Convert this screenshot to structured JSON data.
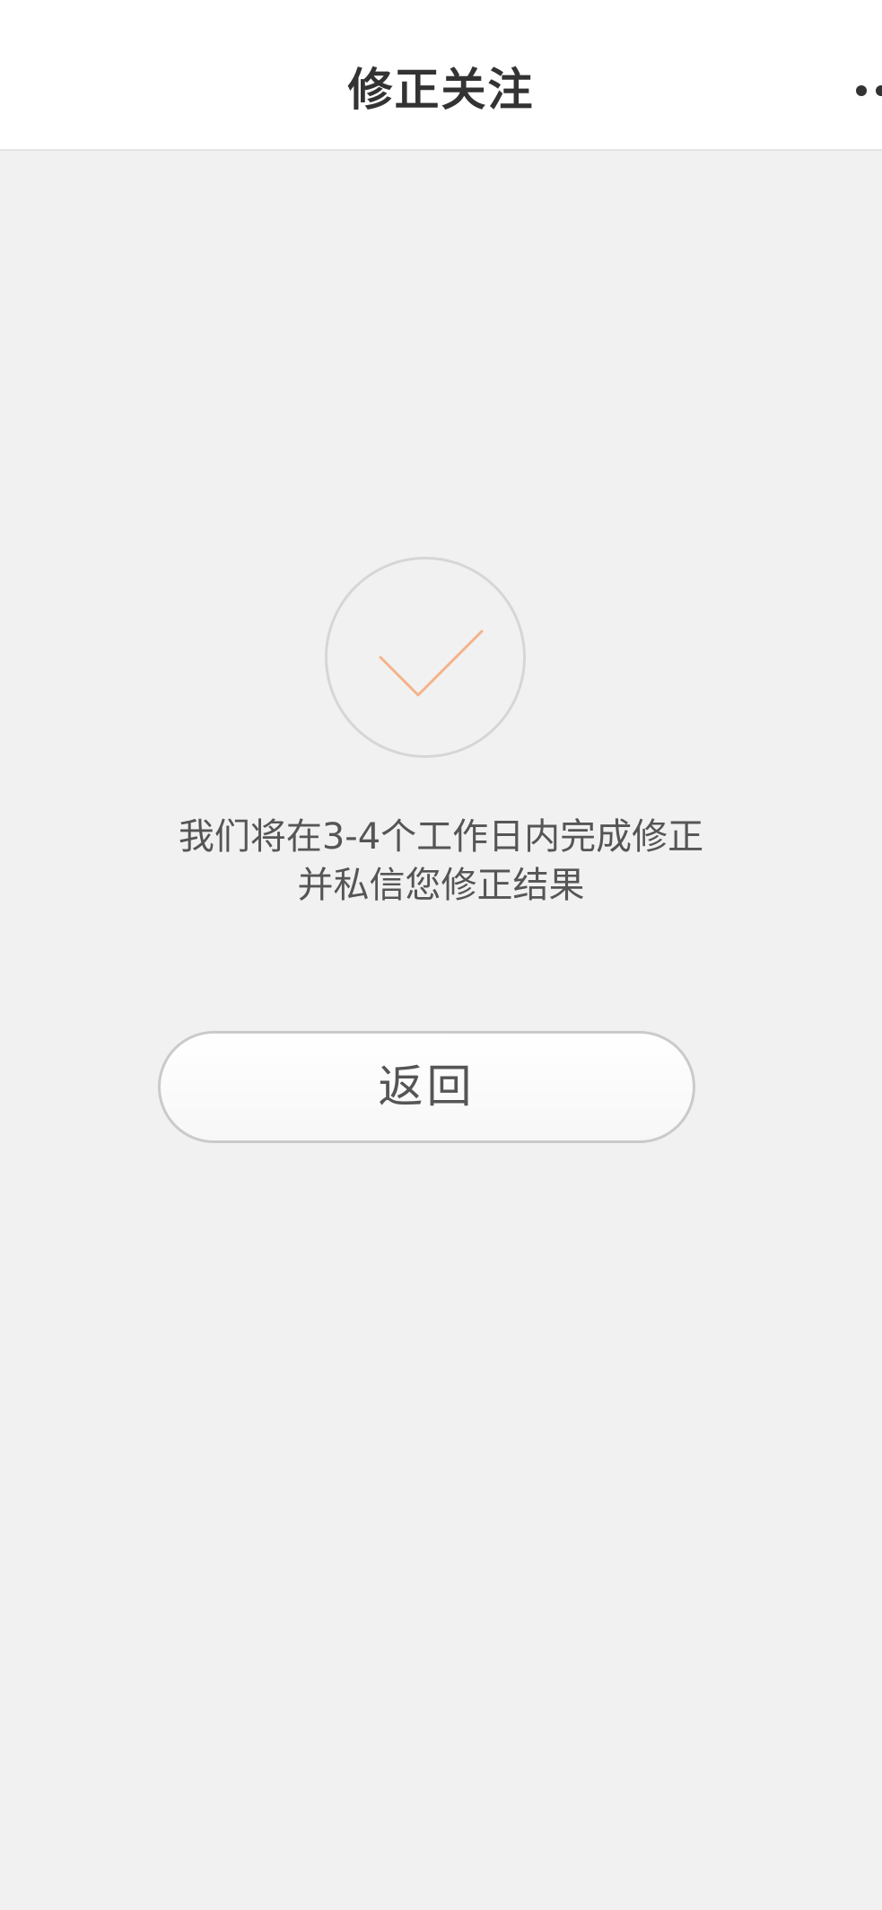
{
  "header": {
    "title": "修正关注",
    "more_icon": "more-dots-icon"
  },
  "result": {
    "icon": "checkmark-icon",
    "icon_color": "#f5b38a",
    "message_line1": "我们将在3-4个工作日内完成修正",
    "message_line2": "并私信您修正结果"
  },
  "actions": {
    "back_label": "返回"
  },
  "colors": {
    "background": "#f1f1f1",
    "nav_background": "#ffffff",
    "text": "#555555",
    "title": "#333333"
  }
}
